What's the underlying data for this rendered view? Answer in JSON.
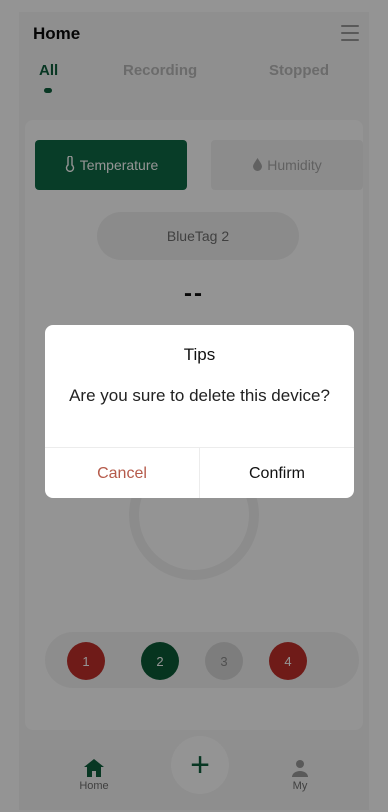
{
  "app": {
    "title": "Home"
  },
  "tabs": [
    {
      "label": "All",
      "active": true
    },
    {
      "label": "Recording",
      "active": false
    },
    {
      "label": "Stopped",
      "active": false
    }
  ],
  "segments": {
    "temperature": "Temperature",
    "humidity": "Humidity"
  },
  "device": {
    "name": "BlueTag 2",
    "reading": "--"
  },
  "levels": [
    {
      "label": "1",
      "color": "#c0302a"
    },
    {
      "label": "2",
      "color": "#0b5a36"
    },
    {
      "label": "3",
      "color": "#d8d8d8"
    },
    {
      "label": "4",
      "color": "#c0302a"
    }
  ],
  "bottom_nav": {
    "add_icon": "+",
    "home_label": "Home",
    "my_label": "My"
  },
  "dialog": {
    "title": "Tips",
    "message": "Are you sure to delete this device?",
    "cancel_label": "Cancel",
    "confirm_label": "Confirm"
  },
  "colors": {
    "accent": "#0f6a46",
    "cancel": "#b55a4a"
  }
}
